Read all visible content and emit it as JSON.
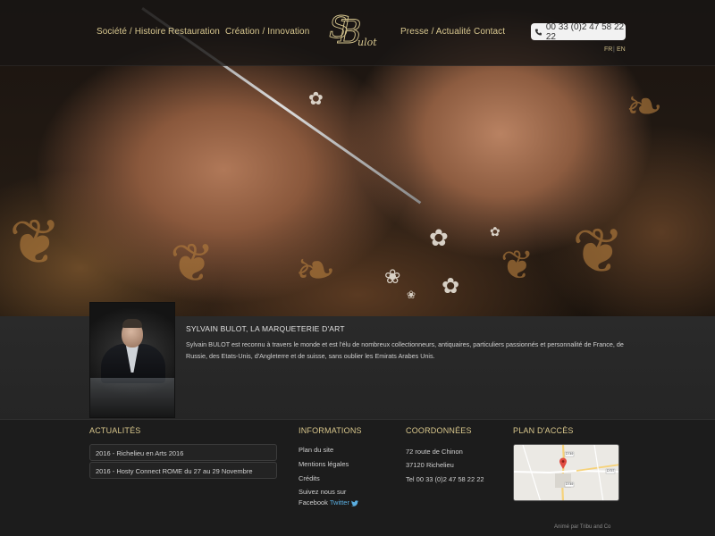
{
  "nav": {
    "left": [
      "Société / Histoire",
      "Restauration",
      "Création / Innovation"
    ],
    "right": [
      "Presse / Actualité",
      "Contact"
    ],
    "logo_text": "S Bulot",
    "phone": "00 33 (0)2 47 58 22 22",
    "languages": [
      "FR",
      "EN"
    ],
    "accent_color": "#d8c78f"
  },
  "bio": {
    "title": "SYLVAIN BULOT, LA MARQUETERIE D'ART",
    "text": "Sylvain BULOT est reconnu à travers le monde et est l'élu de nombreux collectionneurs, antiquaires, particuliers passionnés et personnalité de France, de Russie, des Etats-Unis, d'Angleterre et de suisse, sans oublier les Emirats Arabes Unis."
  },
  "footer": {
    "actualites": {
      "title": "ACTUALITÉS",
      "items": [
        "2016 - Richelieu en Arts 2016",
        "2016 - Hosty Connect ROME du 27 au 29 Novembre"
      ]
    },
    "informations": {
      "title": "INFORMATIONS",
      "links": [
        "Plan du site",
        "Mentions légales",
        "Crédits"
      ],
      "follow": "Suivez nous sur",
      "facebook": "Facebook",
      "twitter": "Twitter"
    },
    "coordonnees": {
      "title": "COORDONNÉES",
      "address1": "72 route de Chinon",
      "address2": "37120 Richelieu",
      "phone": "Tel 00 33 (0)2 47 58 22 22"
    },
    "plan": {
      "title": "PLAN D'ACCÈS",
      "map_labels": [
        "D749",
        "D749",
        "D757"
      ]
    },
    "credit": "Animé par Tribu and Co"
  }
}
